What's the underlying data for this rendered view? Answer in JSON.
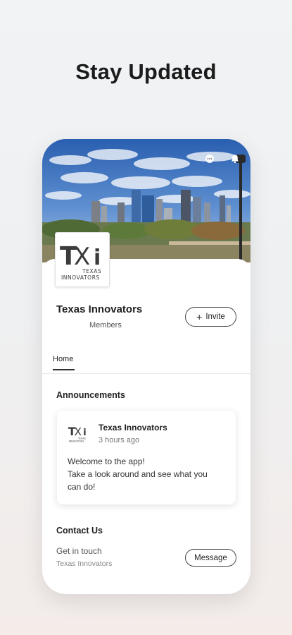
{
  "headline": "Stay Updated",
  "status_icons": [
    "chat-bubble-icon",
    "bell-icon"
  ],
  "group": {
    "name": "Texas Innovators",
    "members_label": "Members",
    "invite_label": "Invite",
    "logo": {
      "mark": "TXi",
      "line1": "TEXAS",
      "line2": "INNOVATORS"
    }
  },
  "tabs": [
    {
      "label": "Home",
      "active": true
    }
  ],
  "announcements": {
    "title": "Announcements",
    "post": {
      "author": "Texas Innovators",
      "time": "3 hours ago",
      "lines": [
        "Welcome to the app!",
        "Take a look around and see what you",
        "can do!"
      ]
    }
  },
  "contact": {
    "title": "Contact Us",
    "subtitle": "Get in touch",
    "name": "Texas Innovators",
    "message_label": "Message"
  },
  "colors": {
    "sky": "#2f6fc0",
    "accent_dark": "#222222",
    "card_shadow": "#e6e6e6"
  }
}
